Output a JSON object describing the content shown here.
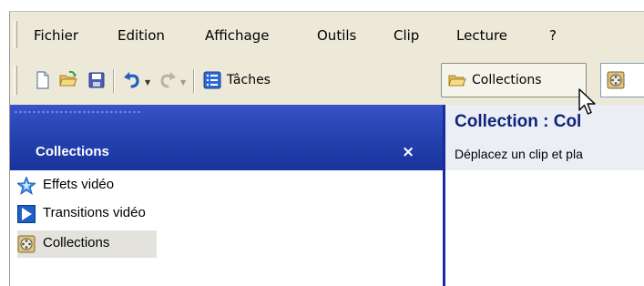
{
  "menu": {
    "items": [
      "Fichier",
      "Edition",
      "Affichage",
      "Outils",
      "Clip",
      "Lecture",
      "?"
    ]
  },
  "toolbar": {
    "new_icon": "new-document-icon",
    "open_icon": "open-folder-icon",
    "save_icon": "save-disk-icon",
    "undo_icon": "undo-arrow-icon",
    "redo_icon": "redo-arrow-icon",
    "tasks_icon": "task-list-icon",
    "tasks_label": "Tâches",
    "collections_icon": "collection-folder-icon",
    "collections_label": "Collections",
    "extra_icon": "film-reel-icon"
  },
  "left_pane": {
    "title": "Collections",
    "close_symbol": "×",
    "items": [
      {
        "label": "Effets vidéo",
        "icon": "star-effects-icon"
      },
      {
        "label": "Transitions vidéo",
        "icon": "transition-icon"
      },
      {
        "label": "Collections",
        "icon": "film-reel-icon"
      }
    ]
  },
  "right_pane": {
    "title": "Collection : Col",
    "subtitle": "Déplacez un clip et pla"
  },
  "colors": {
    "pane_header_blue": "#19339c",
    "toolbar_bg": "#ece9d8",
    "title_blue": "#10237a"
  }
}
